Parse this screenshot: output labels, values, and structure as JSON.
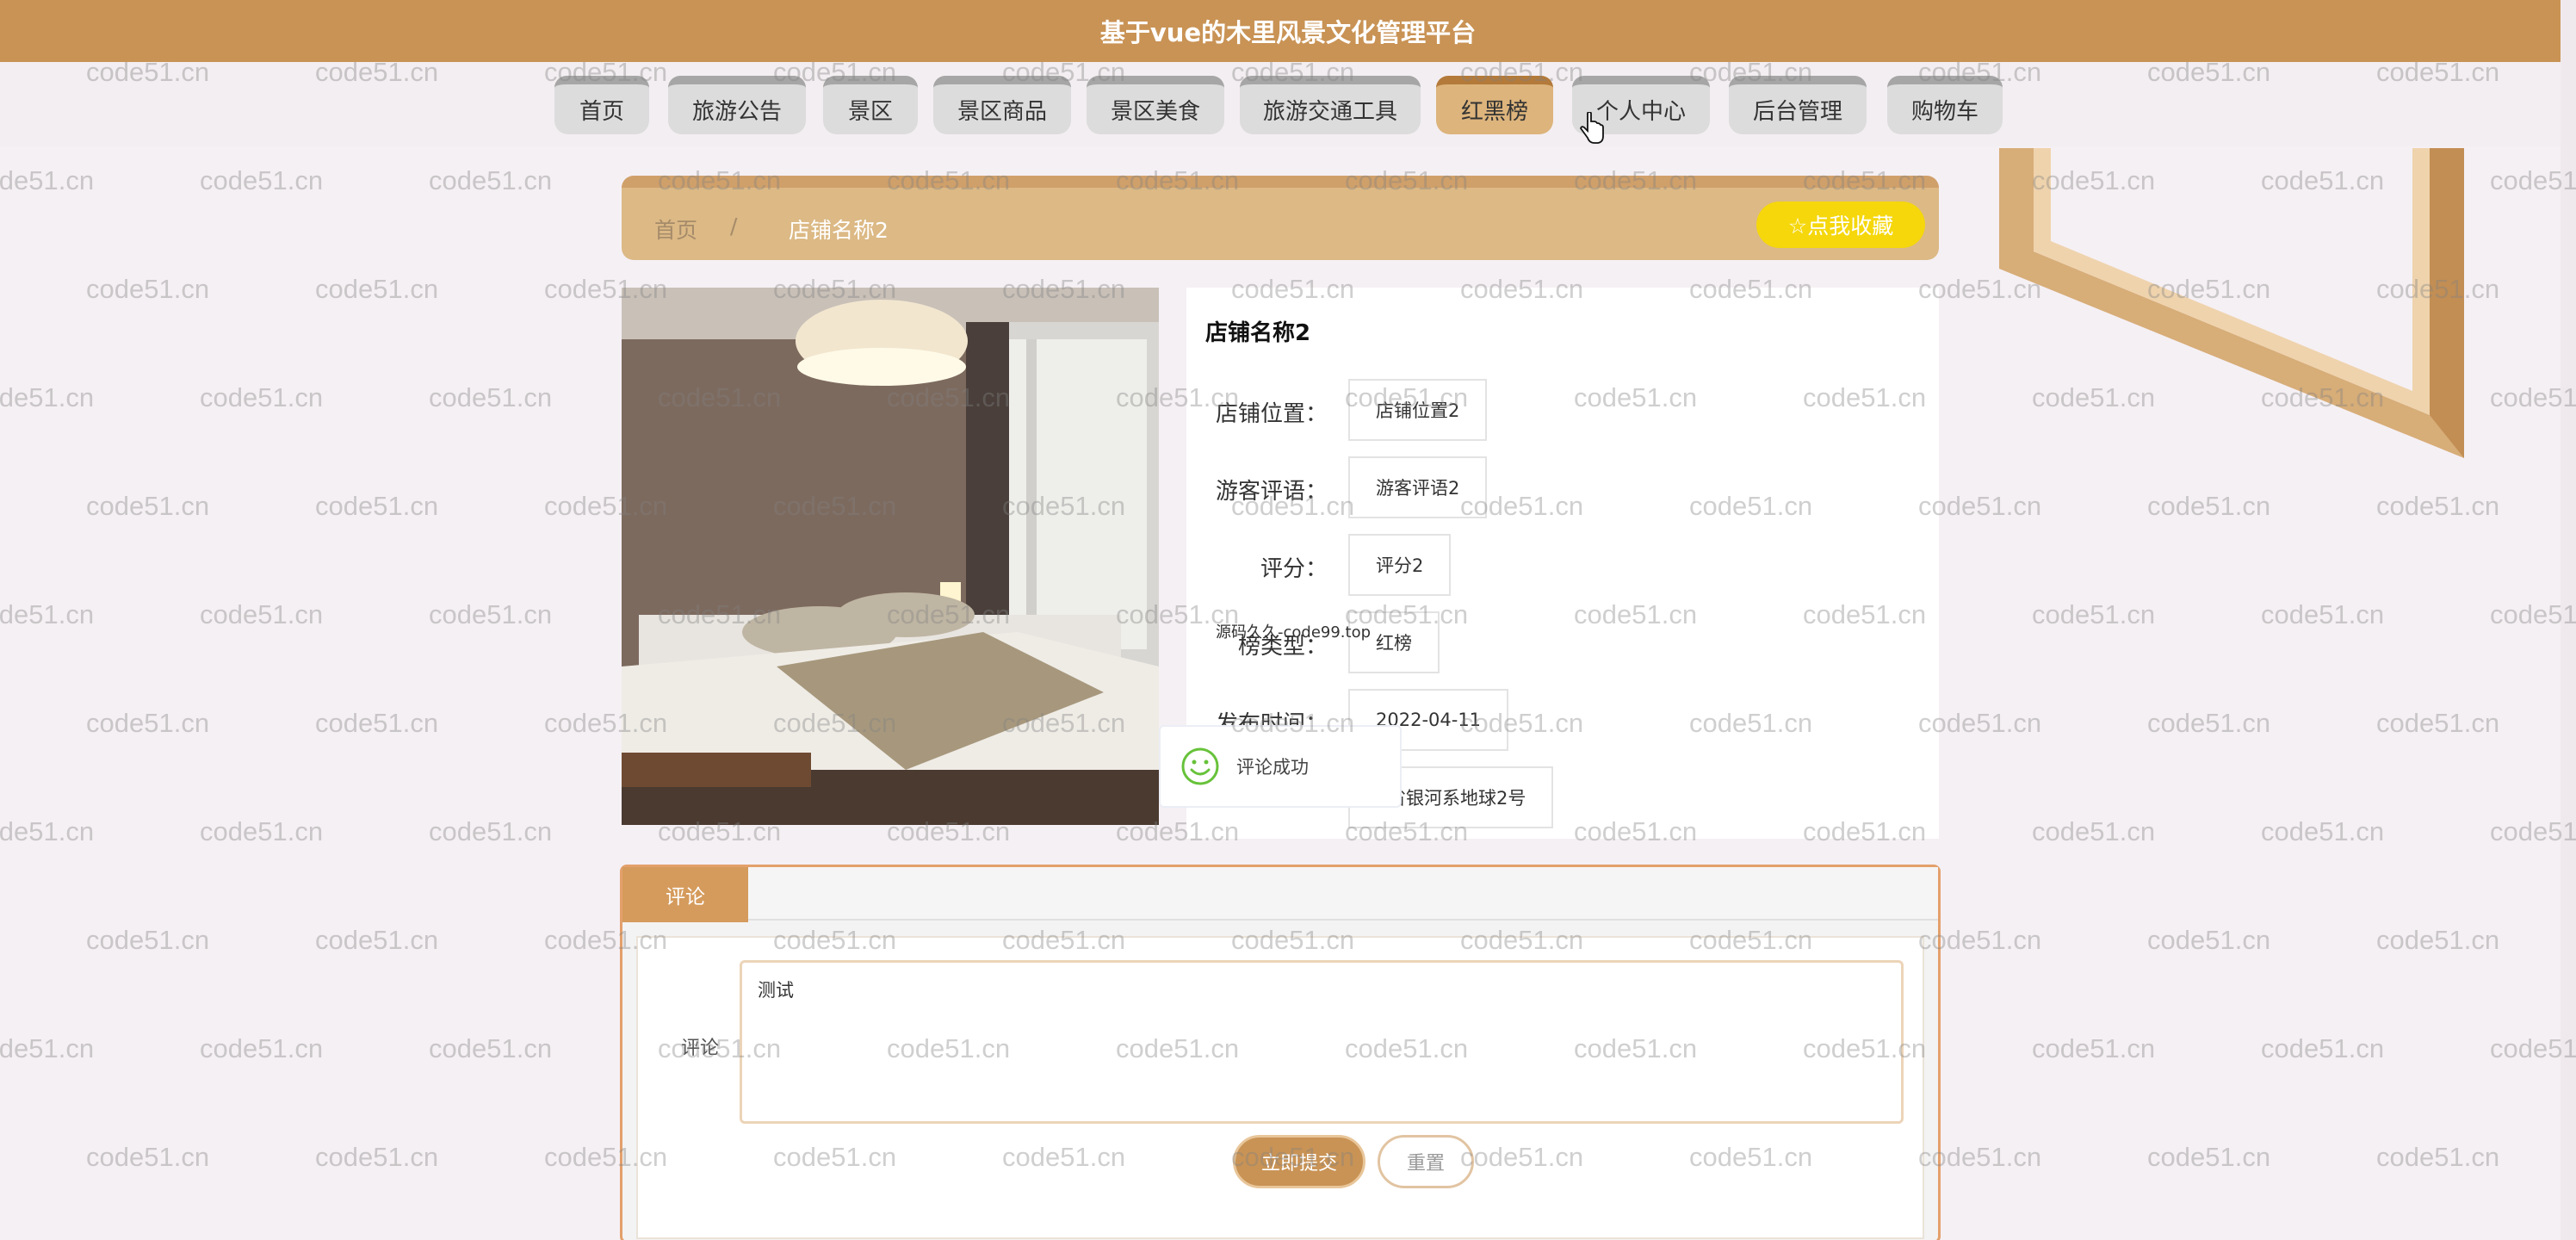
{
  "app": {
    "title": "基于vue的木里风景文化管理平台"
  },
  "nav": {
    "items": [
      {
        "label": "首页"
      },
      {
        "label": "旅游公告"
      },
      {
        "label": "景区"
      },
      {
        "label": "景区商品"
      },
      {
        "label": "景区美食"
      },
      {
        "label": "旅游交通工具"
      },
      {
        "label": "红黑榜",
        "active": true
      },
      {
        "label": "个人中心"
      },
      {
        "label": "后台管理"
      },
      {
        "label": "购物车"
      }
    ]
  },
  "breadcrumb": {
    "home": "首页",
    "separator": "/",
    "current": "店铺名称2"
  },
  "favorite": {
    "label": "☆点我收藏"
  },
  "detail": {
    "name": "店铺名称2",
    "fields": [
      {
        "label": "店铺位置：",
        "value": "店铺位置2"
      },
      {
        "label": "游客评语：",
        "value": "游客评语2"
      },
      {
        "label": "评分：",
        "value": "评分2"
      },
      {
        "label": "榜类型：",
        "value": "红榜"
      },
      {
        "label": "发布时间：",
        "value": "2022-04-11"
      },
      {
        "label": "",
        "value": "省银河系地球2号"
      }
    ]
  },
  "overlay": {
    "text": "源码久久-code99.top"
  },
  "toast": {
    "message": "评论成功"
  },
  "comment": {
    "tab": "评论",
    "label": "评论",
    "value": "测试",
    "submit": "立即提交",
    "reset": "重置"
  },
  "watermark": {
    "text": "code51.cn"
  },
  "colors": {
    "primary": "#c99355",
    "accent": "#f5d70c",
    "success": "#67c23a"
  }
}
